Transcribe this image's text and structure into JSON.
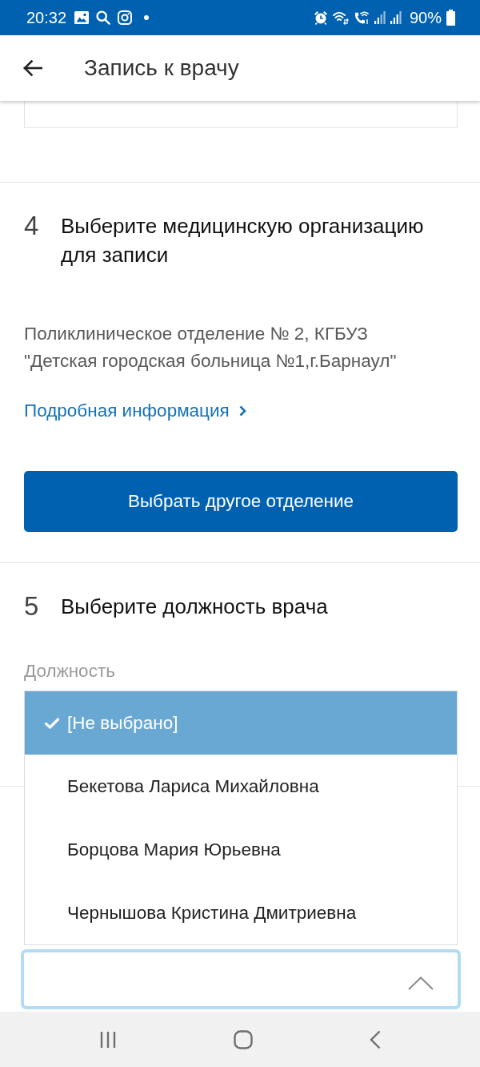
{
  "status_bar": {
    "time": "20:32",
    "battery": "90%"
  },
  "app_bar": {
    "title": "Запись к врачу"
  },
  "organization_step": {
    "number": "4",
    "title": "Выберите медицинскую организацию для записи",
    "address": "Поликлиническое отделение № 2, КГБУЗ \"Детская городская больница №1,г.Барнаул\"",
    "details_link": "Подробная информация",
    "button": "Выбрать другое отделение"
  },
  "position_step": {
    "number": "5",
    "title": "Выберите должность врача",
    "field_label": "Должность",
    "select": {
      "expanded": true
    },
    "options": [
      {
        "label": "[Не выбрано]",
        "selected": true
      },
      {
        "label": "Бекетова Лариса Михайловна",
        "selected": false
      },
      {
        "label": "Борцова Мария Юрьевна",
        "selected": false
      },
      {
        "label": "Чернышова Кристина Дмитриевна",
        "selected": false
      }
    ]
  }
}
